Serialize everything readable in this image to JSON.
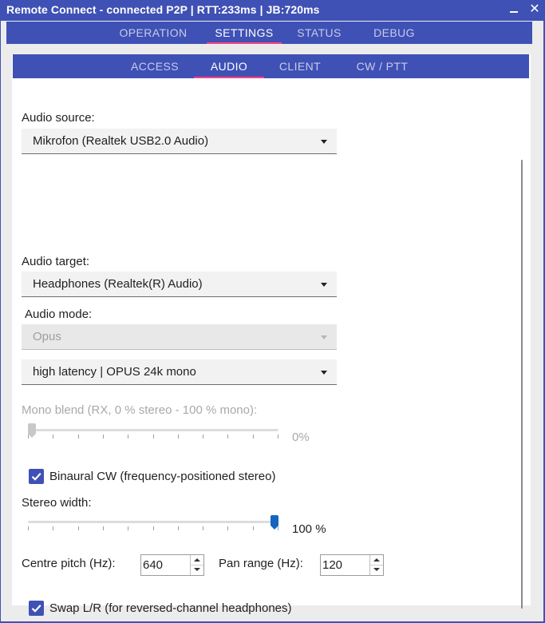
{
  "window": {
    "title": "Remote Connect - connected P2P | RTT:233ms | JB:720ms"
  },
  "main_tabs": [
    {
      "label": "OPERATION"
    },
    {
      "label": "SETTINGS",
      "active": true
    },
    {
      "label": "STATUS"
    },
    {
      "label": "DEBUG"
    }
  ],
  "sub_tabs": [
    {
      "label": "ACCESS"
    },
    {
      "label": "AUDIO",
      "active": true
    },
    {
      "label": "CLIENT"
    },
    {
      "label": "CW / PTT"
    }
  ],
  "audio": {
    "source_label": "Audio source:",
    "source_value": "Mikrofon (Realtek USB2.0 Audio)",
    "target_label": "Audio target:",
    "target_value": "Headphones (Realtek(R) Audio)",
    "mode_label": "Audio mode:",
    "mode_value": "Opus",
    "latency_value": "high latency | OPUS 24k mono",
    "mono_blend_label": "Mono blend (RX, 0 % stereo - 100 % mono):",
    "mono_blend_value_text": "0%",
    "mono_blend_fraction": 0,
    "binaural_label": "Binaural CW (frequency-positioned stereo)",
    "binaural_checked": true,
    "stereo_width_label": "Stereo width:",
    "stereo_width_value_text": "100 %",
    "stereo_width_fraction": 1,
    "centre_pitch_label": "Centre pitch (Hz):",
    "centre_pitch_value": "640",
    "pan_range_label": "Pan range (Hz):",
    "pan_range_value": "120",
    "swap_label": "Swap L/R (for reversed-channel headphones)",
    "swap_checked": true
  },
  "colors": {
    "accent": "#3f51b5",
    "tab_indicator": "#ff4081",
    "slider_handle": "#1565c0"
  }
}
